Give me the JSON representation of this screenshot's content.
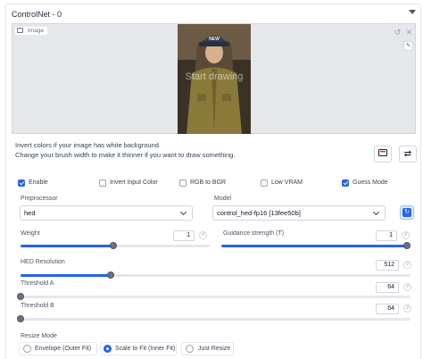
{
  "header": {
    "title": "ControlNet - 0"
  },
  "image_panel": {
    "label": "Image",
    "overlay_text": "Start drawing",
    "cap_text": "NEW"
  },
  "hints": {
    "line1": "Invert colors if your image has white background.",
    "line2": "Change your brush width to make it thinner if you want to draw something."
  },
  "checkboxes": [
    {
      "label": "Enable",
      "checked": true
    },
    {
      "label": "Invert Input Color",
      "checked": false
    },
    {
      "label": "RGB to BGR",
      "checked": false
    },
    {
      "label": "Low VRAM",
      "checked": false
    },
    {
      "label": "Guess Mode",
      "checked": true
    }
  ],
  "preprocessor": {
    "label": "Preprocessor",
    "value": "hed"
  },
  "model": {
    "label": "Model",
    "value": "control_hed-fp16 [13fee50b]"
  },
  "sliders": {
    "weight": {
      "label": "Weight",
      "value": "1",
      "fraction": 0.5
    },
    "guidance": {
      "label": "Guidance strength (T)",
      "value": "1",
      "fraction": 1.0
    },
    "hed_resolution": {
      "label": "HED Resolution",
      "value": "512",
      "fraction": 0.23
    },
    "threshold_a": {
      "label": "Threshold A",
      "value": "64",
      "fraction": 0.0
    },
    "threshold_b": {
      "label": "Threshold B",
      "value": "64",
      "fraction": 0.0
    }
  },
  "resize_mode": {
    "label": "Resize Mode",
    "options": [
      {
        "label": "Envelope (Outer Fit)",
        "selected": false
      },
      {
        "label": "Scale to Fit (Inner Fit)",
        "selected": true
      },
      {
        "label": "Just Resize",
        "selected": false
      }
    ]
  },
  "colors": {
    "accent": "#2563eb",
    "panel_bg": "#e5e7eb",
    "border": "#d1d5db"
  }
}
